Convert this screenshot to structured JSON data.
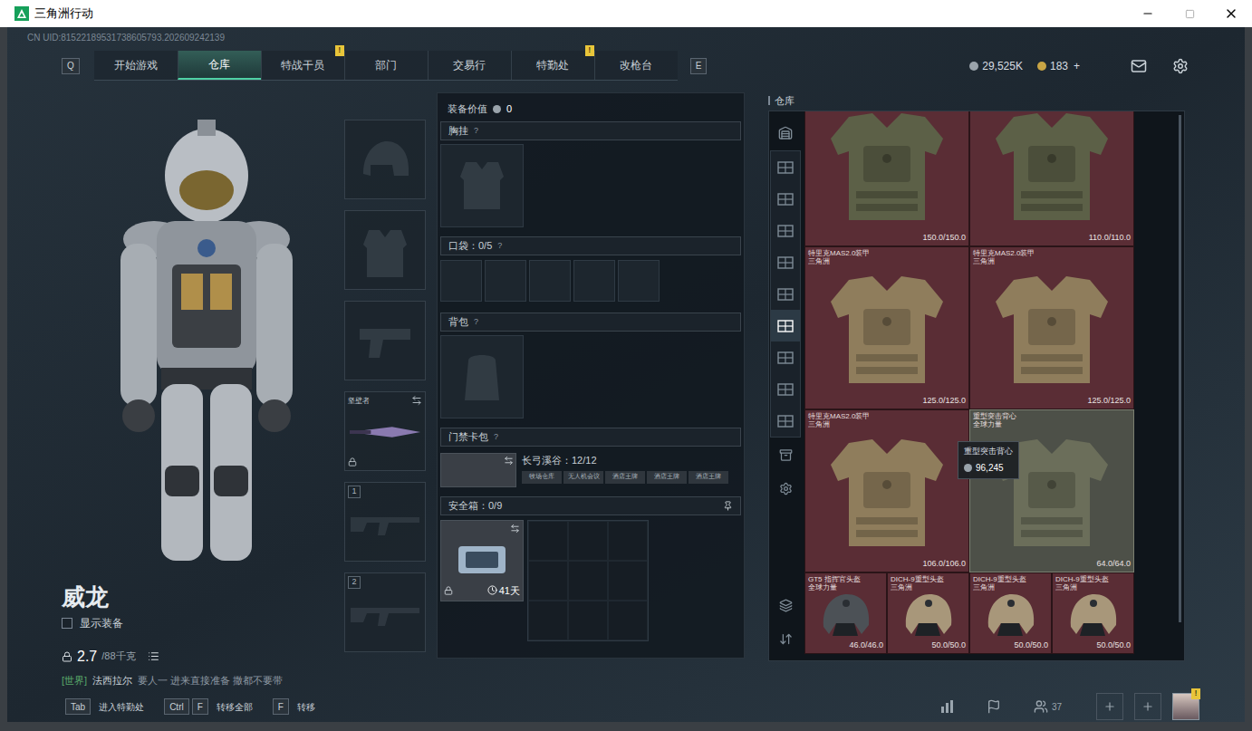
{
  "window": {
    "title": "三角洲行动"
  },
  "uid": "CN UID:81522189531738605793.202609242139",
  "nav": {
    "prev_key": "Q",
    "next_key": "E",
    "tabs": [
      {
        "label": "开始游戏",
        "selected": false,
        "badge": ""
      },
      {
        "label": "仓库",
        "selected": true,
        "badge": ""
      },
      {
        "label": "特战干员",
        "selected": false,
        "badge": "!"
      },
      {
        "label": "部门",
        "selected": false,
        "badge": ""
      },
      {
        "label": "交易行",
        "selected": false,
        "badge": ""
      },
      {
        "label": "特勤处",
        "selected": false,
        "badge": "!"
      },
      {
        "label": "改枪台",
        "selected": false,
        "badge": ""
      }
    ]
  },
  "currency": {
    "coins": "29,525K",
    "tickets": "183",
    "add": "+"
  },
  "operator": {
    "name": "威龙",
    "show_equipment": {
      "label": "显示装备",
      "checked": false
    },
    "weight": "2.7",
    "weight_limit": "/88千克"
  },
  "chat": {
    "channel": "[世界]",
    "sender": "法西拉尔",
    "message": "要人一 进来直接准备 撒都不要带"
  },
  "slots": [
    {
      "kind": "helmet",
      "label": "",
      "number": "",
      "locked": false,
      "swappable": false
    },
    {
      "kind": "armor",
      "label": "",
      "number": "",
      "locked": false,
      "swappable": false
    },
    {
      "kind": "pistol",
      "label": "",
      "number": "",
      "locked": false,
      "swappable": false
    },
    {
      "kind": "melee",
      "label": "坚壁者",
      "number": "",
      "locked": true,
      "swappable": true
    },
    {
      "kind": "primary",
      "label": "",
      "number": "1",
      "locked": false,
      "swappable": false
    },
    {
      "kind": "primary",
      "label": "",
      "number": "2",
      "locked": false,
      "swappable": false
    }
  ],
  "loadout": {
    "value_label": "装备价值",
    "value": "0",
    "chest_rig": {
      "label": "胸挂",
      "help": "?"
    },
    "pockets": {
      "label": "口袋：0/5",
      "help": "?",
      "slots": [
        {
          "filled": false
        },
        {
          "filled": false
        },
        {
          "filled": false
        },
        {
          "filled": false
        },
        {
          "filled": false
        }
      ]
    },
    "backpack": {
      "label": "背包",
      "help": "?"
    },
    "keycard": {
      "label": "门禁卡包",
      "help": "?",
      "item": {
        "title": "长弓溪谷：12/12",
        "swappable": true,
        "tags": [
          "牧场仓库",
          "无人机会议",
          "酒店王牌",
          "酒店王牌",
          "酒店王牌"
        ]
      }
    },
    "safe_box": {
      "label": "安全箱：0/9",
      "pinned": true,
      "item": {
        "days": "41天",
        "locked": true,
        "swappable": true
      }
    }
  },
  "warehouse": {
    "title": "仓库",
    "tabs": [
      {
        "kind": "vault",
        "selected": false
      },
      {
        "kind": "shelf",
        "selected": false
      },
      {
        "kind": "shelf",
        "selected": false
      },
      {
        "kind": "shelf",
        "selected": false
      },
      {
        "kind": "shelf",
        "selected": false
      },
      {
        "kind": "shelf",
        "selected": false
      },
      {
        "kind": "shelf",
        "selected": true
      },
      {
        "kind": "shelf",
        "selected": false
      },
      {
        "kind": "shelf",
        "selected": false
      },
      {
        "kind": "shelf",
        "selected": false
      },
      {
        "kind": "extra",
        "selected": false
      },
      {
        "kind": "gear",
        "selected": false
      },
      {
        "kind": "layers",
        "selected": false
      },
      {
        "kind": "sort",
        "selected": false
      }
    ],
    "items": [
      {
        "kind": "armor",
        "name": "",
        "brand": "",
        "durability": "150.0/150.0",
        "color": "#5c6047",
        "marked": true,
        "hovered": false
      },
      {
        "kind": "armor",
        "name": "",
        "brand": "",
        "durability": "110.0/110.0",
        "color": "#5c6047",
        "marked": true,
        "hovered": false
      },
      {
        "kind": "armor",
        "name": "特里克MAS2.0装甲",
        "brand": "三角洲",
        "durability": "125.0/125.0",
        "color": "#8f7d5c",
        "marked": true,
        "hovered": false
      },
      {
        "kind": "armor",
        "name": "特里克MAS2.0装甲",
        "brand": "三角洲",
        "durability": "125.0/125.0",
        "color": "#8f7d5c",
        "marked": true,
        "hovered": false
      },
      {
        "kind": "armor",
        "name": "特里克MAS2.0装甲",
        "brand": "三角洲",
        "durability": "106.0/106.0",
        "color": "#8f7d5c",
        "marked": true,
        "hovered": false
      },
      {
        "kind": "armor",
        "name": "重型突击背心",
        "brand": "全球力量",
        "durability": "64.0/64.0",
        "color": "#6b6e5a",
        "marked": false,
        "hovered": true
      },
      {
        "kind": "helmet",
        "name": "GT5 指挥官头盔",
        "brand": "全球力量",
        "durability": "46.0/46.0",
        "color": "#4c5156",
        "marked": true,
        "hovered": false
      },
      {
        "kind": "helmet",
        "name": "DICH-9重型头盔",
        "brand": "三角洲",
        "durability": "50.0/50.0",
        "color": "#a8977a",
        "marked": true,
        "hovered": false
      },
      {
        "kind": "helmet",
        "name": "DICH-9重型头盔",
        "brand": "三角洲",
        "durability": "50.0/50.0",
        "color": "#a8977a",
        "marked": true,
        "hovered": false
      },
      {
        "kind": "helmet",
        "name": "DICH-9重型头盔",
        "brand": "三角洲",
        "durability": "50.0/50.0",
        "color": "#a8977a",
        "marked": true,
        "hovered": false
      }
    ],
    "tooltip": {
      "name": "重型突击背心",
      "price": "96,245"
    }
  },
  "hotkeys": [
    {
      "keys": [
        "Tab"
      ],
      "label": "进入特勤处"
    },
    {
      "keys": [
        "Ctrl",
        "F"
      ],
      "label": "转移全部"
    },
    {
      "keys": [
        "F"
      ],
      "label": "转移"
    }
  ],
  "social": {
    "friends": "37",
    "notice": "!"
  }
}
